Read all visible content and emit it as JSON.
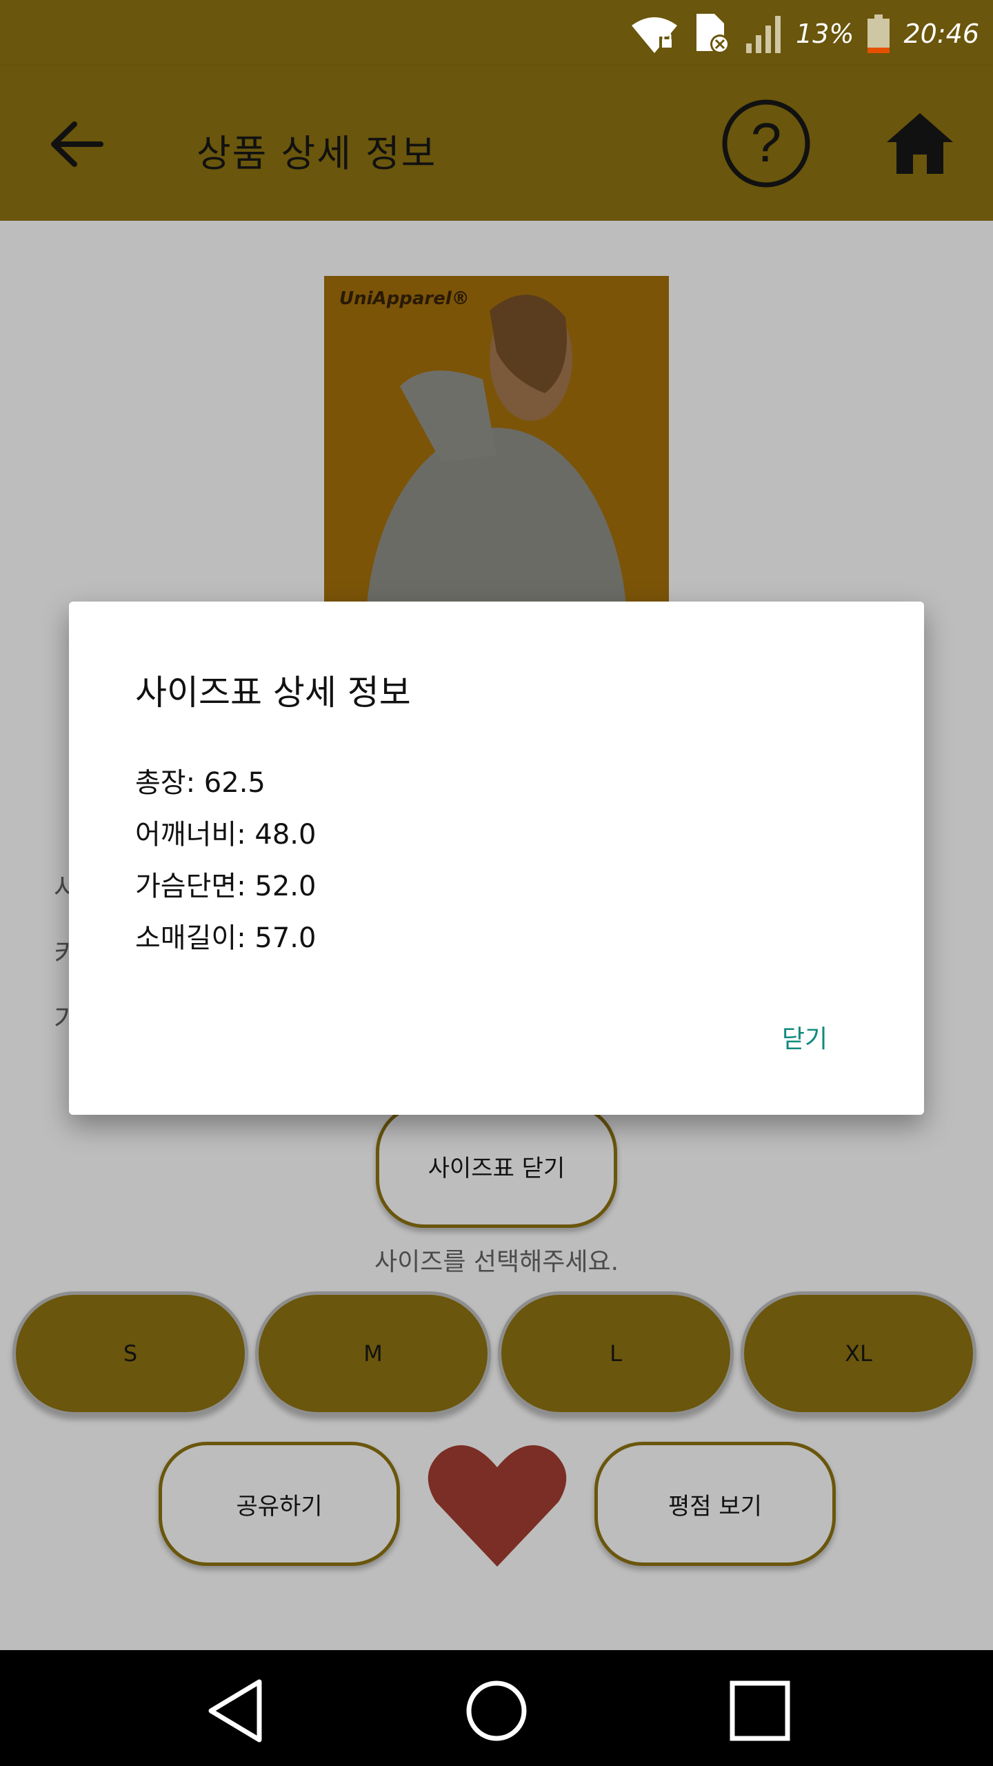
{
  "status_bar": {
    "battery_percent": "13%",
    "time": "20:46",
    "icons": [
      "wifi-lock-icon",
      "sim-off-icon",
      "signal-icon",
      "battery-icon"
    ]
  },
  "app_bar": {
    "title": "상품 상세 정보",
    "back_icon": "arrow-left-icon",
    "help_icon": "help-circle-icon",
    "home_icon": "home-icon"
  },
  "product": {
    "brand_logo_text": "UniApparel®"
  },
  "background_text": [
    "사",
    "키",
    "가"
  ],
  "size_chart": {
    "close_button_label": "사이즈표 닫기",
    "hint": "사이즈를 선택해주세요.",
    "sizes": [
      "S",
      "M",
      "L",
      "XL"
    ]
  },
  "actions": {
    "share_label": "공유하기",
    "rating_label": "평점 보기",
    "like_icon": "heart-icon"
  },
  "dialog": {
    "title": "사이즈표 상세 정보",
    "lines": [
      "총장: 62.5",
      "어깨너비: 48.0",
      "가슴단면: 52.0",
      "소매길이: 57.0"
    ],
    "close_label": "닫기"
  },
  "colors": {
    "accent": "#6a560c",
    "dialog_button": "#0f8a7e",
    "heart": "#7b2e25"
  },
  "nav": {
    "icons": [
      "back-triangle-icon",
      "home-circle-icon",
      "recents-square-icon"
    ]
  }
}
